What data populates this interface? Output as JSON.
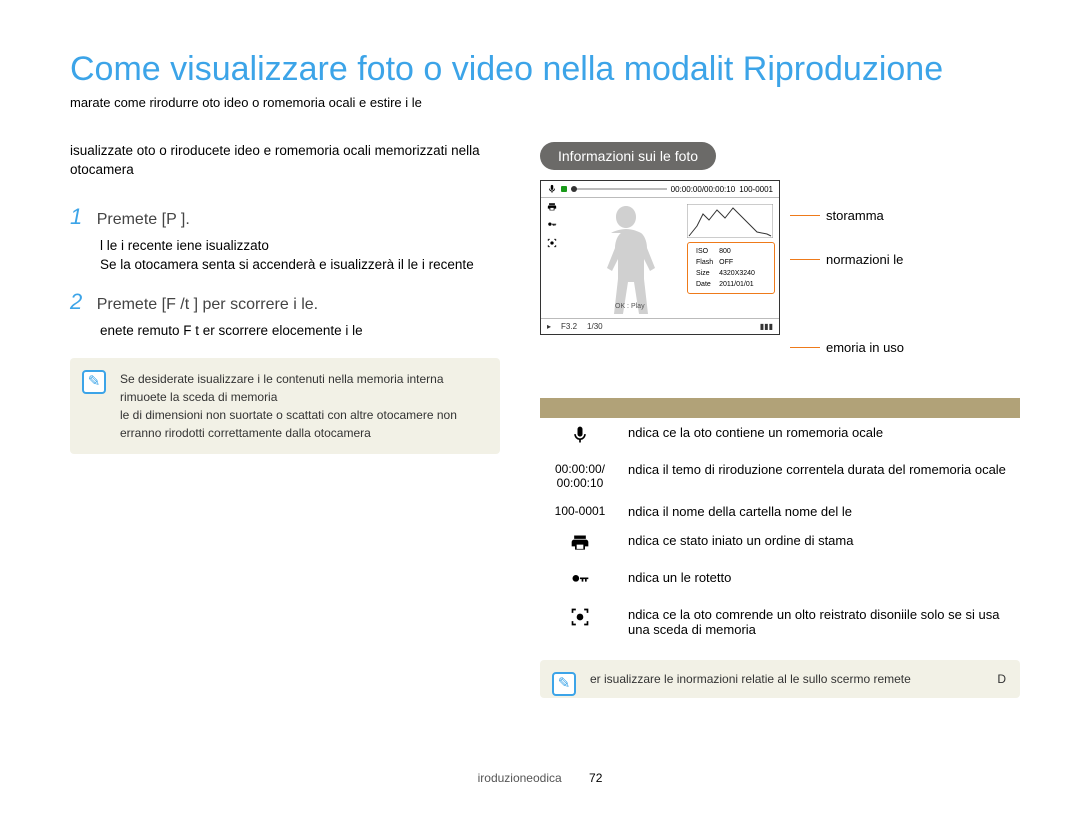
{
  "title": "Come visualizzare foto o video nella modalit  Riproduzione",
  "subtitle": "marate come rirodurre oto ideo o romemoria ocali e estire i le",
  "left": {
    "intro": "isualizzate oto o riroducete ideo e romemoria ocali memorizzati nella otocamera",
    "step1_num": "1",
    "step1_head": "Premete [P  ].",
    "step1_body_a": "l le i recente iene isualizzato",
    "step1_body_b": "Se la otocamera  senta si accenderà e isualizzerà il le i recente",
    "step2_num": "2",
    "step2_head": "Premete [F /t   ] per scorrere i le.",
    "step2_body": "enete remuto      F   t     er scorrere elocemente i le",
    "note_a": "Se desiderate isualizzare i le contenuti nella memoria interna rimuoete la sceda di memoria",
    "note_b": "le di dimensioni non suortate o scattati con altre otocamere non erranno rirodotti correttamente dalla otocamera"
  },
  "right": {
    "badge": "Informazioni sui  le foto",
    "callout_histo": "storamma",
    "callout_info": "normazioni le",
    "callout_mem": "emoria in uso",
    "screen": {
      "top_time": "00:00:00/00:00:10",
      "top_folder": "100-0001",
      "ok_play": "OK : Play",
      "info_iso_k": "ISO",
      "info_iso_v": "800",
      "info_flash_k": "Flash",
      "info_flash_v": "OFF",
      "info_size_k": "Size",
      "info_size_v": "4320X3240",
      "info_date_k": "Date",
      "info_date_v": "2011/01/01",
      "bot_f": "F3.2",
      "bot_s": "1/30"
    },
    "table": {
      "r1_desc": "ndica ce la oto contiene un romemoria ocale",
      "r2_ico": "00:00:00/\n00:00:10",
      "r2_desc": "ndica il temo di riroduzione correntela durata del romemoria ocale",
      "r3_ico": "100-0001",
      "r3_desc": "ndica il nome della cartella  nome del le",
      "r4_desc": "ndica ce  stato iniato un ordine di stama",
      "r5_desc": "ndica un le rotetto",
      "r6_desc": "ndica ce la oto comrende un olto reistrato disoniile solo se si usa una sceda di memoria"
    },
    "tip": "er isualizzare le inormazioni relatie al le sullo scermo remete",
    "tip_right": "D"
  },
  "footer": {
    "section": "iroduzioneodica",
    "page": "72"
  }
}
